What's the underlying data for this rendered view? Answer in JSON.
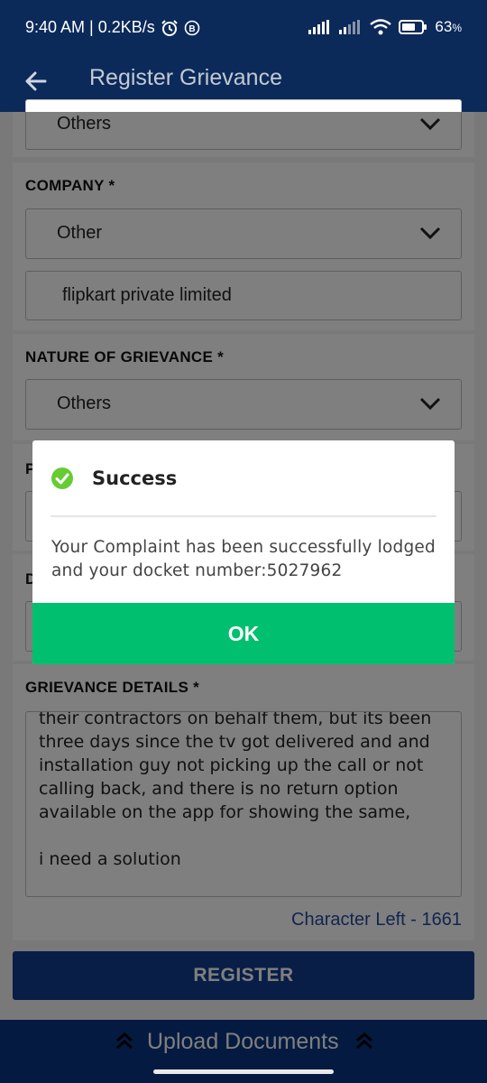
{
  "status_bar": {
    "time_speed": "9:40 AM | 0.2KB/s",
    "battery": "63",
    "battery_unit": "%",
    "icons": [
      "alarm-icon",
      "b-badge-icon",
      "signal-icon",
      "signal-icon",
      "wifi-icon",
      "battery-icon"
    ]
  },
  "app_bar": {
    "title": "Register Grievance",
    "back_icon": "arrow-left-icon"
  },
  "form": {
    "category_value": "Others",
    "company_label": "COMPANY *",
    "company_value": "Other",
    "company_name": "flipkart private limited",
    "nature_label": "NATURE OF GRIEVANCE *",
    "nature_value": "Others",
    "hidden_label_1_initial": "P",
    "hidden_label_2_initial": "D",
    "details_label": "GRIEVANCE DETAILS *",
    "details_text": "their contractors on behalf them, but its been three days since the tv got delivered and and installation guy not picking up the call or not calling back, and there is no return option available on the app for showing the same,\n\ni need a solution",
    "char_left": "Character Left - 1661",
    "register_label": "REGISTER",
    "upload_label": "Upload Documents"
  },
  "dialog": {
    "title": "Success",
    "message": "Your Complaint has been successfully lodged and your docket number:5027962",
    "ok_label": "OK",
    "accent": "#00bf6f",
    "icon": "check-circle-icon"
  },
  "colors": {
    "header": "#0b2a5a",
    "primary": "#103d8f",
    "success": "#00bf6f"
  }
}
